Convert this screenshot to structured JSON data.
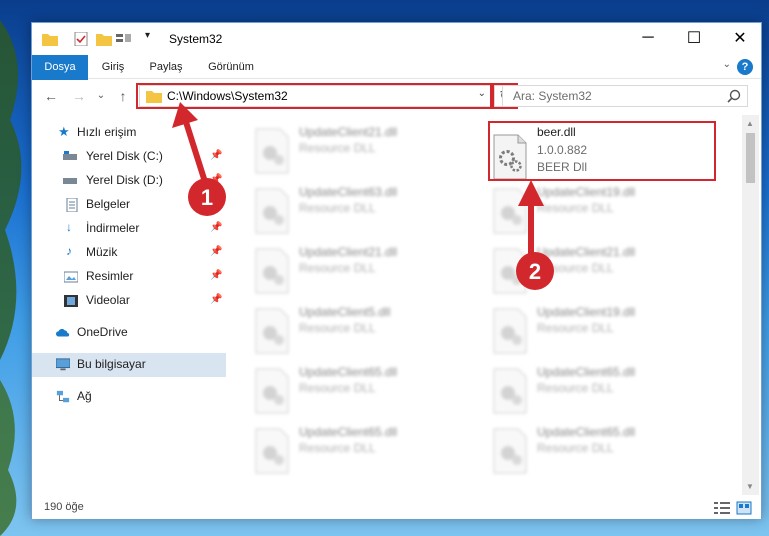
{
  "window": {
    "title": "System32",
    "controls": {
      "minimize": "─",
      "maximize": "☐",
      "close": "✕"
    }
  },
  "ribbon": {
    "tabs": [
      {
        "label": "Dosya",
        "active": true
      },
      {
        "label": "Giriş"
      },
      {
        "label": "Paylaş"
      },
      {
        "label": "Görünüm"
      }
    ],
    "help": "?"
  },
  "navigation": {
    "address": "C:\\Windows\\System32",
    "search_placeholder": "Ara: System32"
  },
  "sidebar": {
    "items": [
      {
        "label": "Hızlı erişim",
        "icon": "star-icon",
        "pinned": false
      },
      {
        "label": "Yerel Disk (C:)",
        "icon": "drive-icon",
        "pinned": true
      },
      {
        "label": "Yerel Disk (D:)",
        "icon": "drive-icon",
        "pinned": true
      },
      {
        "label": "Belgeler",
        "icon": "document-icon",
        "pinned": true
      },
      {
        "label": "İndirmeler",
        "icon": "download-icon",
        "pinned": true
      },
      {
        "label": "Müzik",
        "icon": "music-icon",
        "pinned": true
      },
      {
        "label": "Resimler",
        "icon": "pictures-icon",
        "pinned": true
      },
      {
        "label": "Videolar",
        "icon": "video-icon",
        "pinned": true
      },
      {
        "label": "OneDrive",
        "icon": "cloud-icon"
      },
      {
        "label": "Bu bilgisayar",
        "icon": "computer-icon",
        "selected": true
      },
      {
        "label": "Ağ",
        "icon": "network-icon"
      }
    ]
  },
  "files": {
    "left_column": [
      {
        "name": "UpdateClient21.dll",
        "desc": "Resource DLL"
      },
      {
        "name": "UpdateClient63.dll",
        "desc": "Resource DLL"
      },
      {
        "name": "UpdateClient21.dll",
        "desc": "Resource DLL"
      },
      {
        "name": "UpdateClient5.dll",
        "desc": "Resource DLL"
      },
      {
        "name": "UpdateClient65.dll",
        "desc": "Resource DLL"
      },
      {
        "name": "UpdateClient65.dll",
        "desc": "Resource DLL"
      }
    ],
    "highlighted": {
      "name": "beer.dll",
      "version": "1.0.0.882",
      "desc": "BEER Dll"
    },
    "right_column": [
      {
        "name": "UpdateClient19.dll",
        "desc": "Resource DLL"
      },
      {
        "name": "UpdateClient21.dll",
        "desc": "Resource DLL"
      },
      {
        "name": "UpdateClient19.dll",
        "desc": "Resource DLL"
      },
      {
        "name": "UpdateClient65.dll",
        "desc": "Resource DLL"
      },
      {
        "name": "UpdateClient65.dll",
        "desc": "Resource DLL"
      }
    ]
  },
  "status": {
    "item_count": "190 öğe"
  },
  "annotations": [
    {
      "number": "1"
    },
    {
      "number": "2"
    }
  ],
  "colors": {
    "accent": "#1979ca",
    "highlight": "#d2272c",
    "selected": "#d9e4f1"
  }
}
